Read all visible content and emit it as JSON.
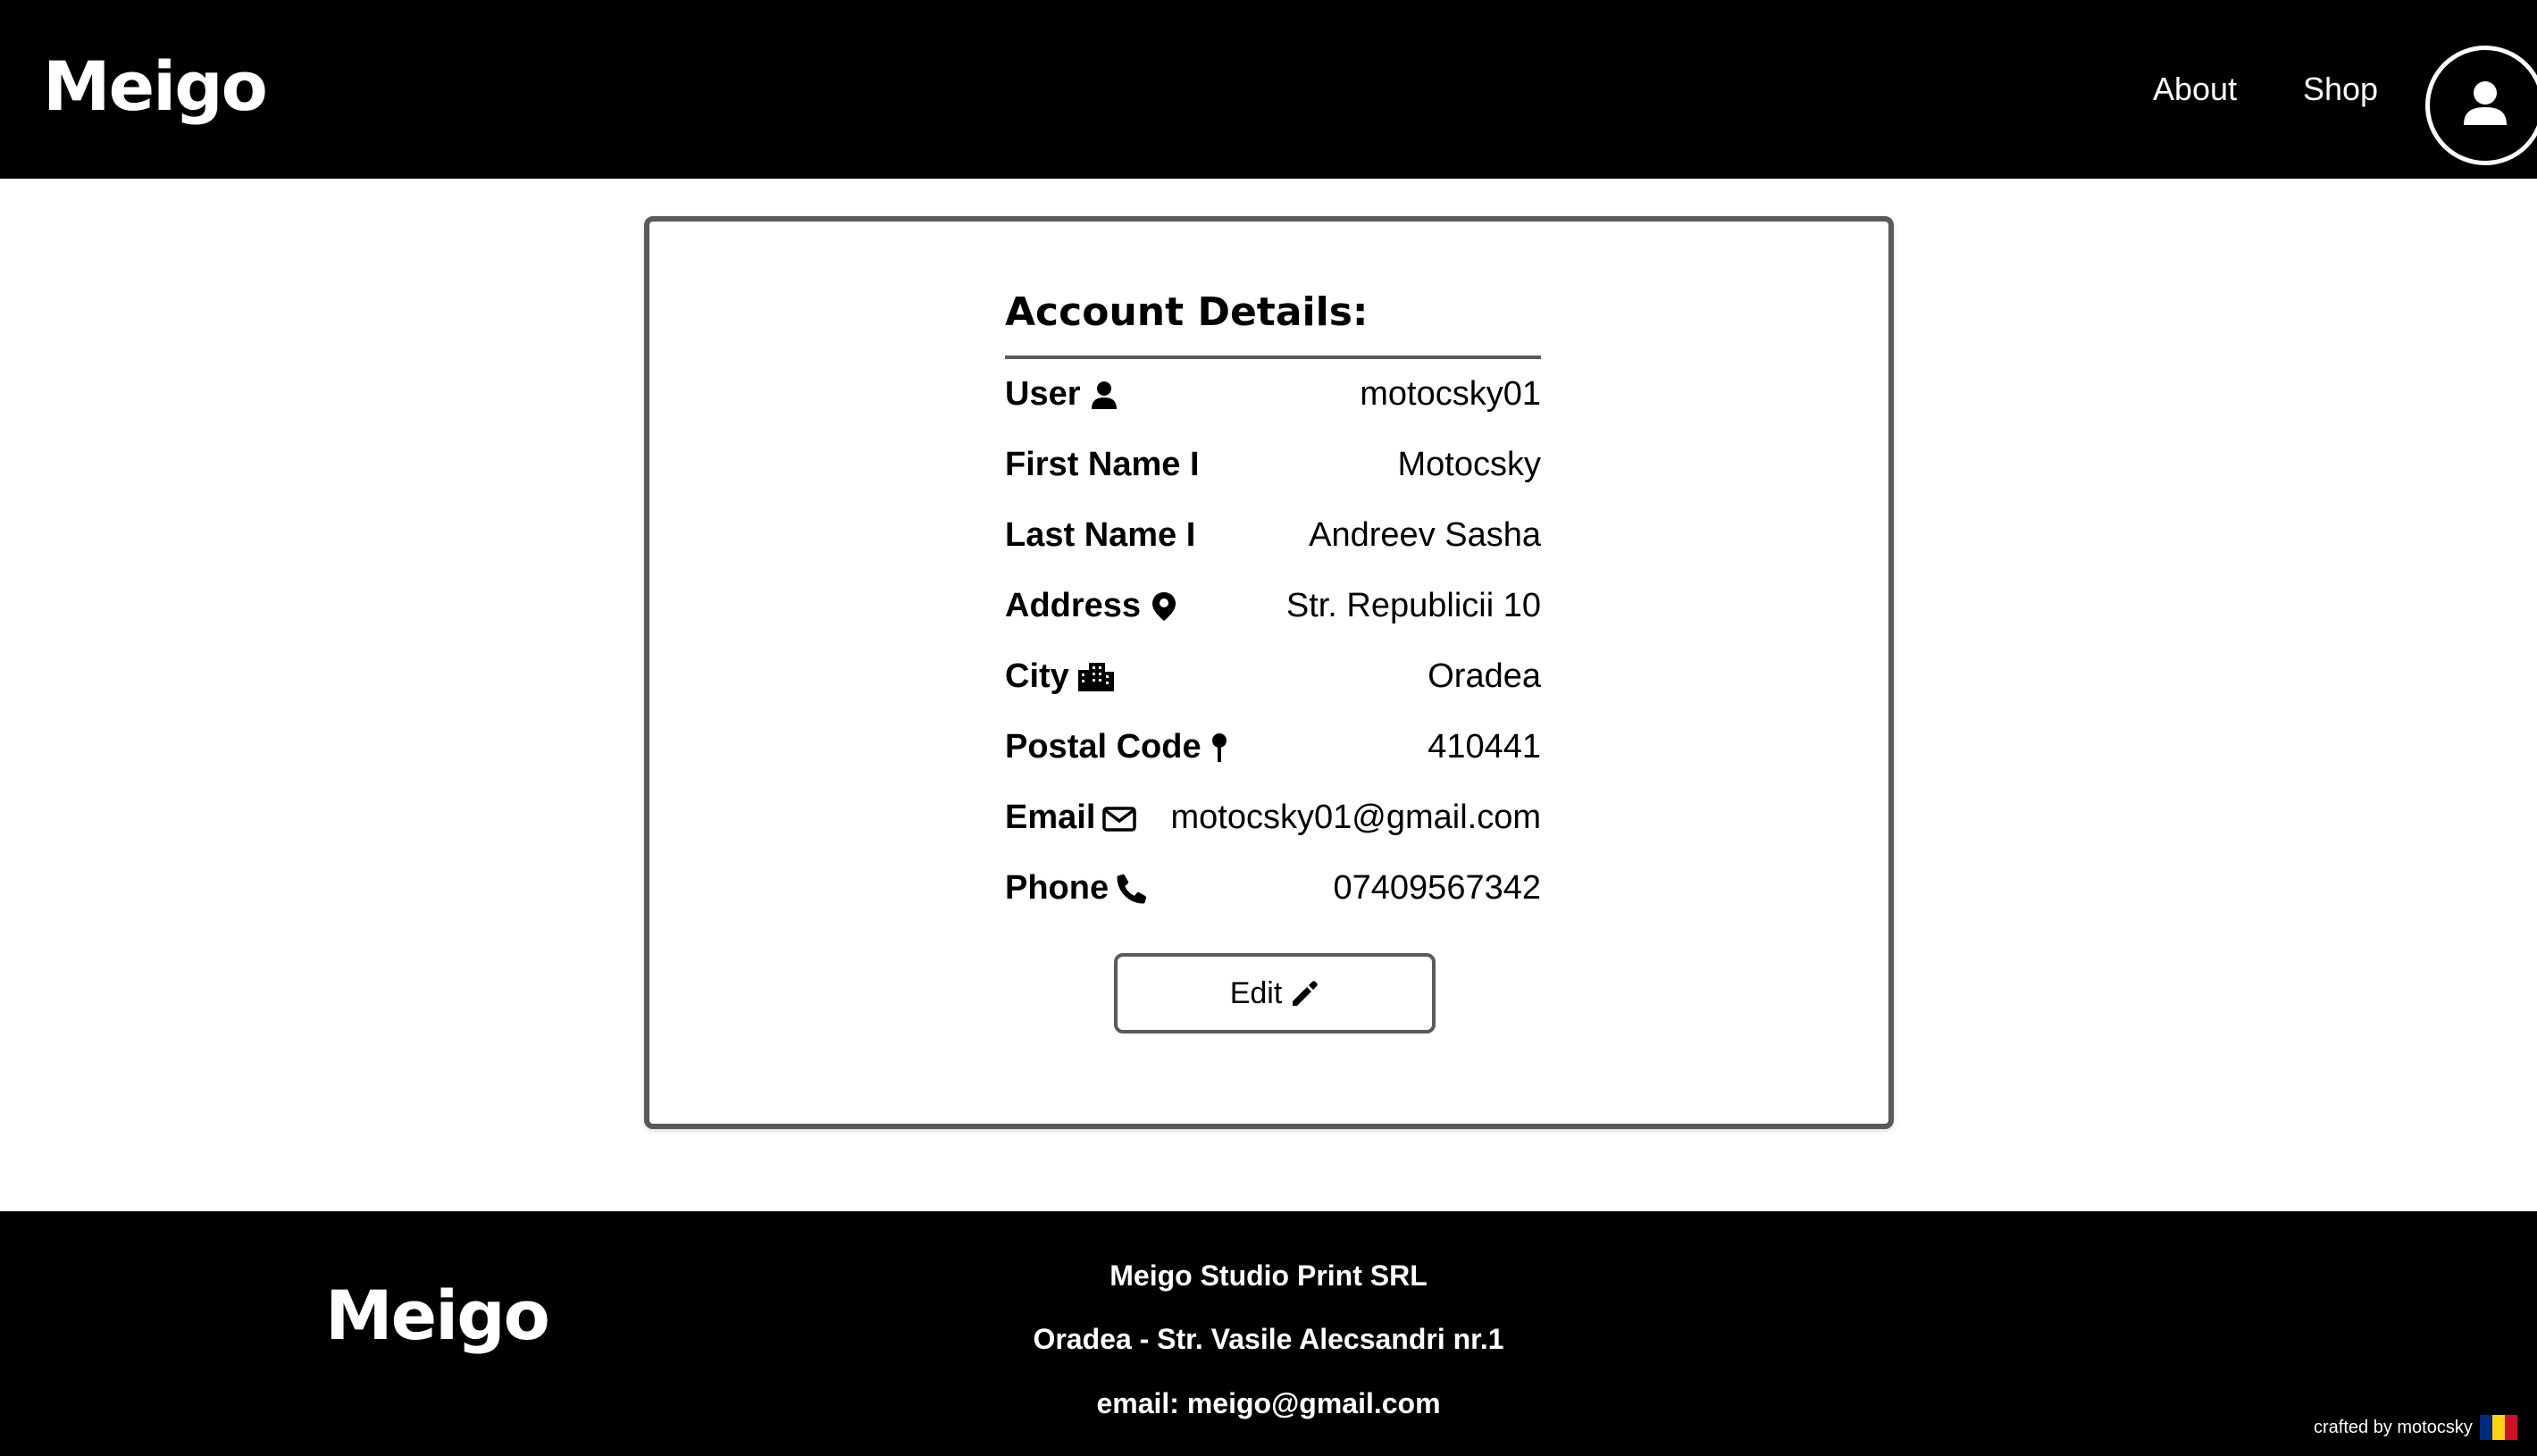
{
  "header": {
    "logo": "Meigo",
    "nav": [
      {
        "label": "About"
      },
      {
        "label": "Shop"
      }
    ]
  },
  "account": {
    "title": "Account Details:",
    "rows": [
      {
        "label": "User",
        "icon": "user-icon",
        "value": "motocsky01"
      },
      {
        "label": "First Name I",
        "icon": "",
        "value": "Motocsky"
      },
      {
        "label": "Last Name I",
        "icon": "",
        "value": "Andreev Sasha"
      },
      {
        "label": "Address",
        "icon": "map-marker-icon",
        "value": "Str. Republicii 10"
      },
      {
        "label": "City",
        "icon": "city-icon",
        "value": "Oradea"
      },
      {
        "label": "Postal Code",
        "icon": "map-pin-icon",
        "value": "410441"
      },
      {
        "label": "Email",
        "icon": "envelope-icon",
        "value": "motocsky01@gmail.com"
      },
      {
        "label": "Phone",
        "icon": "phone-icon",
        "value": "07409567342"
      }
    ],
    "edit_label": "Edit"
  },
  "footer": {
    "logo": "Meigo",
    "company": "Meigo Studio Print SRL",
    "address": "Oradea - Str. Vasile Alecsandri nr.1",
    "email": "email: meigo@gmail.com",
    "credit": "crafted by motocsky",
    "flag_colors": [
      "#002B7F",
      "#FCD116",
      "#CE1126"
    ]
  },
  "colors": {
    "background": "#ffffff",
    "header_bg": "#000000",
    "border": "#5a5a5a"
  }
}
